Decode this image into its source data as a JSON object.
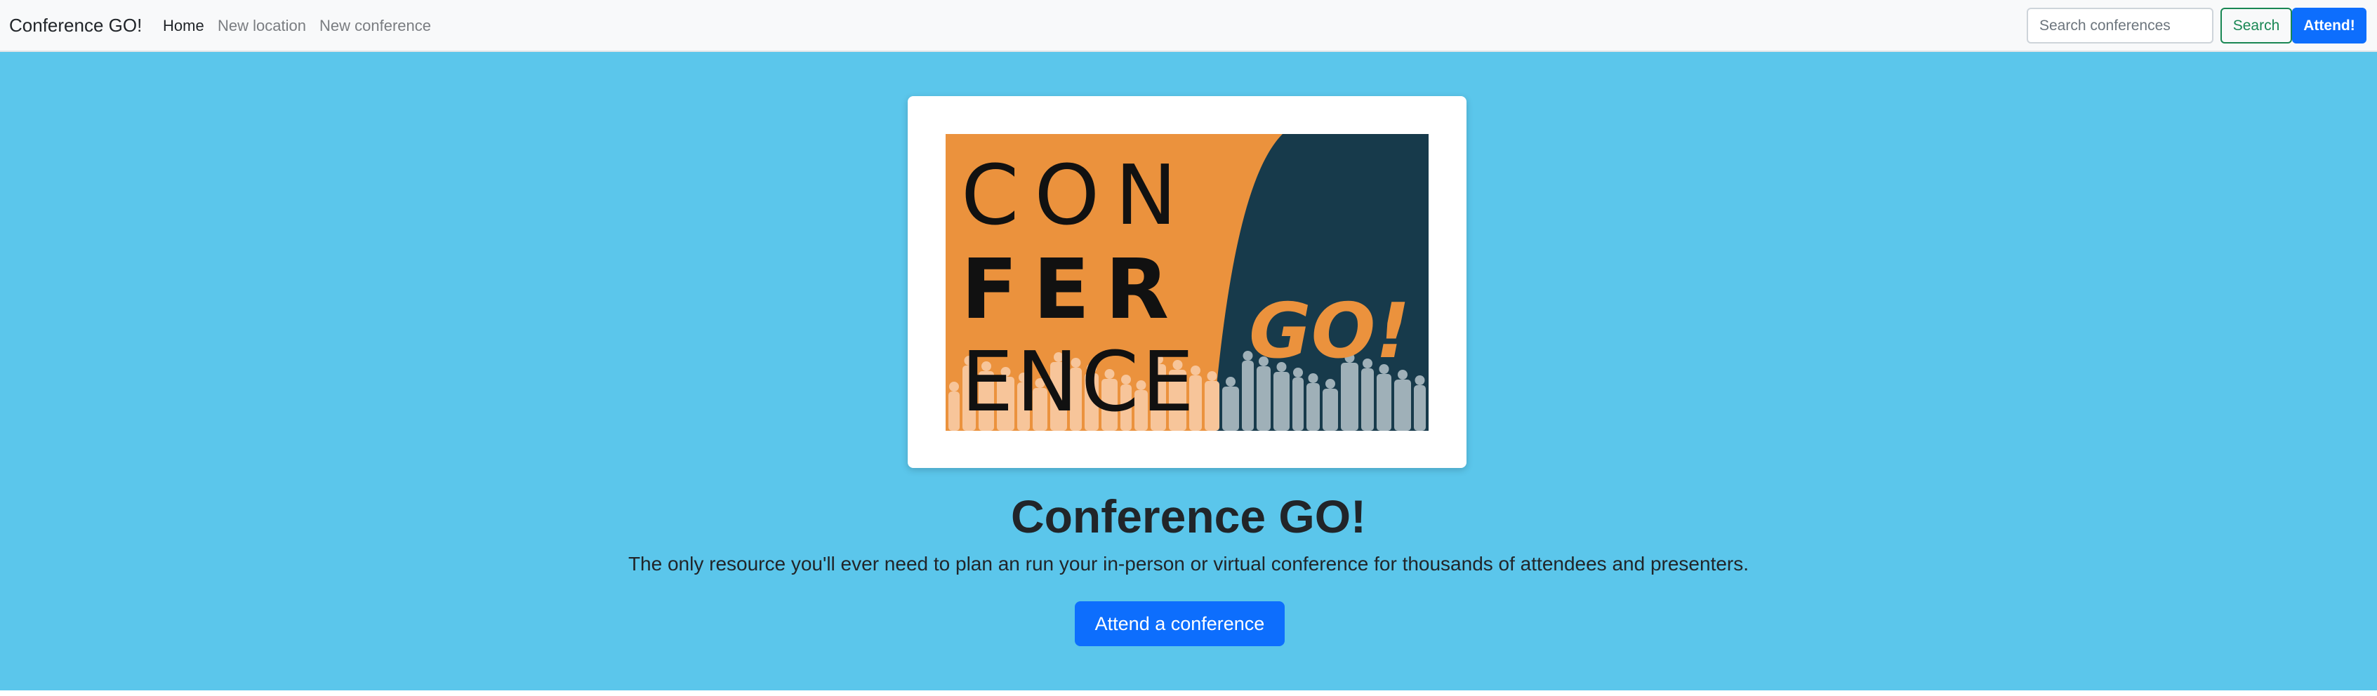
{
  "navbar": {
    "brand": "Conference GO!",
    "links": [
      {
        "label": "Home",
        "active": true
      },
      {
        "label": "New location",
        "active": false
      },
      {
        "label": "New conference",
        "active": false
      }
    ],
    "search": {
      "placeholder": "Search conferences",
      "value": ""
    },
    "search_button": "Search",
    "attend_button": "Attend!"
  },
  "hero": {
    "logo": {
      "line1": "CON",
      "line2": "FER",
      "line3": "ENCE",
      "tagline": "GO!",
      "colors": {
        "orange": "#eb923d",
        "navy": "#173a4b",
        "crowd_light": "#f7c59a",
        "crowd_dark": "#9fb0b8"
      }
    },
    "title": "Conference GO!",
    "lead": "The only resource you'll ever need to plan an run your in-person or virtual conference for thousands of attendees and presenters.",
    "cta_button": "Attend a conference"
  },
  "colors": {
    "hero_bg": "#5bc6eb",
    "primary": "#0d6efd",
    "success": "#198754",
    "navbar_bg": "#f8f9fa"
  }
}
